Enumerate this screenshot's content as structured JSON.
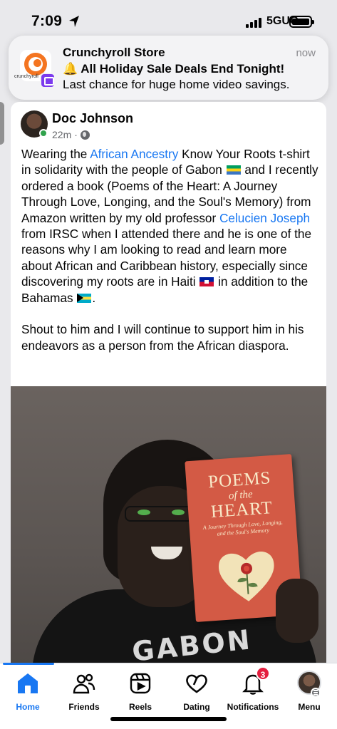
{
  "status_bar": {
    "time": "7:09",
    "network": "5GUC"
  },
  "notification": {
    "app": "Crunchyroll Store",
    "icon_text": "crunchyroll",
    "time": "now",
    "title": "🔔 All Holiday Sale Deals End Tonight!",
    "body": "Last chance for huge home video savings."
  },
  "post": {
    "author": "Doc Johnson",
    "time": "22m",
    "segments": {
      "s1": "Wearing the ",
      "link1": "African Ancestry",
      "s2": " Know Your Roots t-shirt in solidarity with the people of Gabon ",
      "s3": " and I recently ordered a book (Poems of the Heart: A Journey Through Love, Longing, and the Soul's Memory) from Amazon written by my old professor ",
      "link2": "Celucien Joseph",
      "s4": " from IRSC when I attended there and he is one of the reasons why I am looking to read and learn more about African and Caribbean history, especially since discovering my roots are in Haiti ",
      "s5": " in addition to the Bahamas ",
      "s6": ".",
      "para2": "Shout to him and I will continue to support him in his endeavors as a person from the African diaspora."
    },
    "photo": {
      "book_title_1": "POEMS",
      "book_title_2": "of the",
      "book_title_3": "HEART",
      "book_subtitle": "A Journey Through Love, Longing, and the Soul's Memory",
      "shirt_text": "GABON"
    }
  },
  "tabbar": {
    "home": "Home",
    "friends": "Friends",
    "reels": "Reels",
    "dating": "Dating",
    "notifications": "Notifications",
    "notifications_badge": "3",
    "menu": "Menu"
  },
  "colors": {
    "accent": "#1877f2",
    "badge": "#e41e3f",
    "online": "#31a24c"
  }
}
